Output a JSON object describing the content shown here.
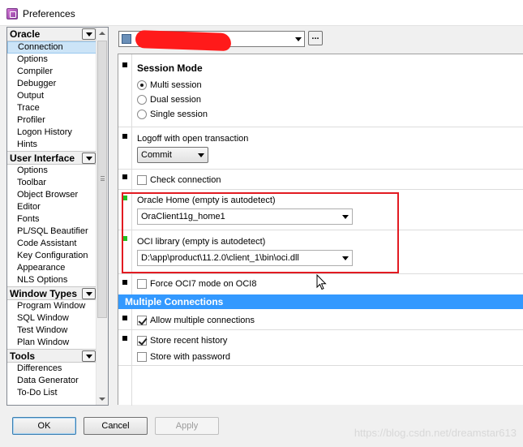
{
  "window": {
    "title": "Preferences"
  },
  "nav": {
    "groups": [
      {
        "label": "Oracle",
        "items": [
          "Connection",
          "Options",
          "Compiler",
          "Debugger",
          "Output",
          "Trace",
          "Profiler",
          "Logon History",
          "Hints"
        ]
      },
      {
        "label": "User Interface",
        "items": [
          "Options",
          "Toolbar",
          "Object Browser",
          "Editor",
          "Fonts",
          "PL/SQL Beautifier",
          "Code Assistant",
          "Key Configuration",
          "Appearance",
          "NLS Options"
        ]
      },
      {
        "label": "Window Types",
        "items": [
          "Program Window",
          "SQL Window",
          "Test Window",
          "Plan Window"
        ]
      },
      {
        "label": "Tools",
        "items": [
          "Differences",
          "Data Generator",
          "To-Do List"
        ]
      }
    ],
    "selected": "Connection"
  },
  "profile": {
    "dots_label": "..."
  },
  "session_mode": {
    "heading": "Session Mode",
    "options": [
      {
        "label": "Multi session",
        "selected": true
      },
      {
        "label": "Dual session",
        "selected": false
      },
      {
        "label": "Single session",
        "selected": false
      }
    ]
  },
  "logoff": {
    "label": "Logoff with open transaction",
    "value": "Commit"
  },
  "check_connection": {
    "label": "Check connection",
    "checked": false
  },
  "oracle_home": {
    "label": "Oracle Home (empty is autodetect)",
    "value": "OraClient11g_home1"
  },
  "oci_library": {
    "label": "OCI library (empty is autodetect)",
    "value": "D:\\app\\product\\11.2.0\\client_1\\bin\\oci.dll"
  },
  "force_oci7": {
    "label": "Force OCI7 mode on OCI8",
    "checked": false
  },
  "multiple_connections": {
    "header": "Multiple Connections",
    "allow": {
      "label": "Allow multiple connections",
      "checked": true
    },
    "store_history": {
      "label": "Store recent history",
      "checked": true
    },
    "store_password": {
      "label": "Store with password",
      "checked": false
    }
  },
  "buttons": {
    "ok": "OK",
    "cancel": "Cancel",
    "apply": "Apply"
  },
  "watermark": "https://blog.csdn.net/dreamstar613",
  "colors": {
    "group_header": "#3399ff",
    "highlight": "#e21b22",
    "redaction": "#ff1a1a",
    "marker_changed": "#22c022"
  }
}
